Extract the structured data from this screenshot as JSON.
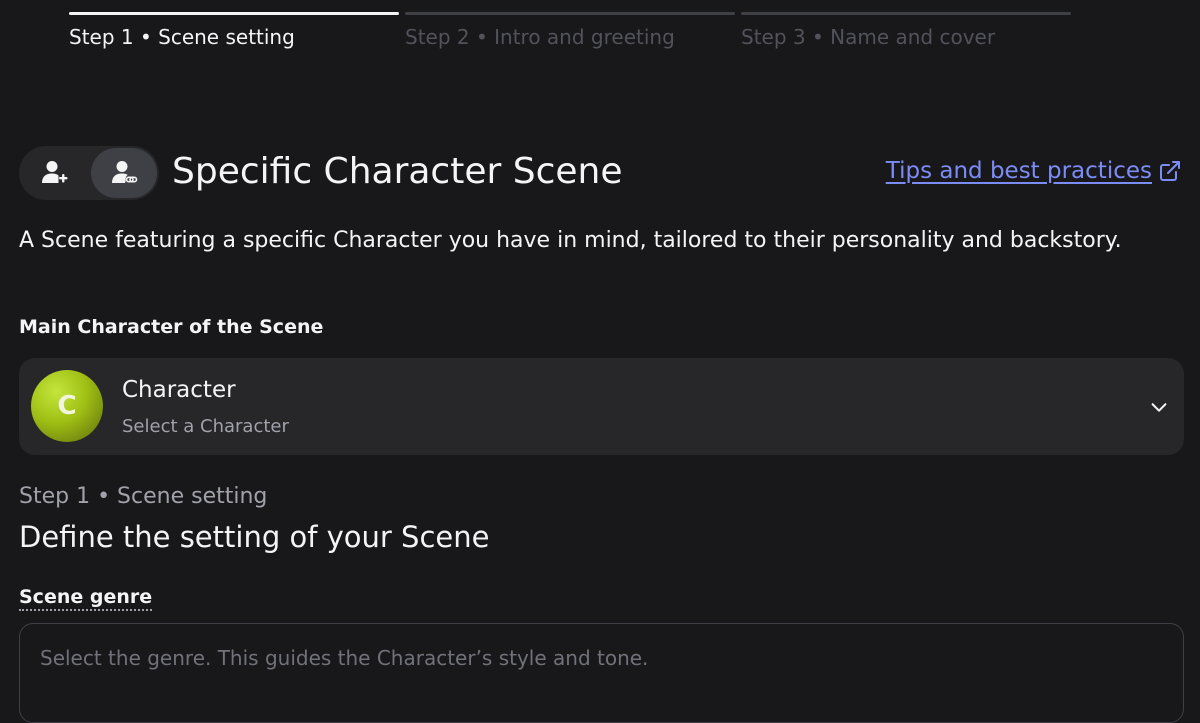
{
  "stepper": {
    "steps": [
      {
        "label": "Step 1 • Scene setting",
        "active": true
      },
      {
        "label": "Step 2 • Intro and greeting",
        "active": false
      },
      {
        "label": "Step 3 • Name and cover",
        "active": false
      }
    ]
  },
  "header": {
    "toggle_icons": [
      "add-user-icon",
      "user-link-icon"
    ],
    "active_toggle": "user-link-icon",
    "title": "Specific Character Scene",
    "tips_link": "Tips and best practices",
    "tips_icon": "external-link-icon"
  },
  "description": "A Scene featuring a specific Character you have in mind, tailored to their personality and backstory.",
  "main_character": {
    "section_label": "Main Character of the Scene",
    "avatar_letter": "C",
    "name": "Character",
    "placeholder": "Select a Character",
    "dropdown_icon": "chevron-down-icon"
  },
  "setting": {
    "step_caption": "Step 1 • Scene setting",
    "title": "Define the setting of your Scene",
    "genre_label": "Scene genre",
    "genre_placeholder": "Select the genre. This guides the Character’s style and tone."
  },
  "colors": {
    "background": "#18181b",
    "card": "#27272a",
    "link": "#7c8cf5",
    "avatar": "#9fbf14"
  }
}
